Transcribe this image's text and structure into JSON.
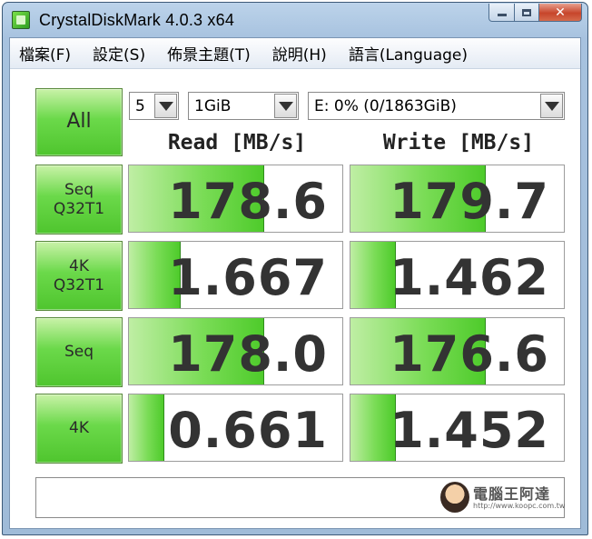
{
  "window": {
    "title": "CrystalDiskMark 4.0.3 x64",
    "close_glyph": "✕"
  },
  "menu": [
    {
      "label": "檔案(F)"
    },
    {
      "label": "設定(S)"
    },
    {
      "label": "佈景主題(T)"
    },
    {
      "label": "說明(H)"
    },
    {
      "label": "語言(Language)"
    }
  ],
  "controls": {
    "all_button": "All",
    "test_count": "5",
    "test_size": "1GiB",
    "drive": "E: 0% (0/1863GiB)"
  },
  "headers": {
    "read": "Read [MB/s]",
    "write": "Write [MB/s]"
  },
  "tests": [
    {
      "label_line1": "Seq",
      "label_line2": "Q32T1",
      "read": "178.6",
      "write": "179.7",
      "read_fill": 0.63,
      "write_fill": 0.63
    },
    {
      "label_line1": "4K",
      "label_line2": "Q32T1",
      "read": "1.667",
      "write": "1.462",
      "read_fill": 0.24,
      "write_fill": 0.21
    },
    {
      "label_line1": "Seq",
      "label_line2": "",
      "read": "178.0",
      "write": "176.6",
      "read_fill": 0.63,
      "write_fill": 0.63
    },
    {
      "label_line1": "4K",
      "label_line2": "",
      "read": "0.661",
      "write": "1.452",
      "read_fill": 0.16,
      "write_fill": 0.21
    }
  ],
  "watermark": {
    "title": "電腦王阿達",
    "url": "http://www.koopc.com.tw"
  },
  "colors": {
    "accent_green": "#4fc52e",
    "bar_green": "#7adc56"
  }
}
